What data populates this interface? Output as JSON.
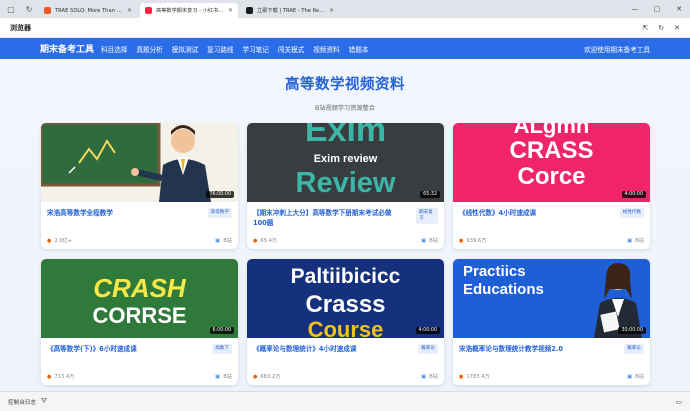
{
  "browser": {
    "tabs": [
      {
        "label": "TRAE SOLO: More Than Co...",
        "favicon_color": "#f15a24",
        "active": false
      },
      {
        "label": "高等数学期末复习 - 小红书搜索",
        "favicon_color": "#ff2442",
        "active": false
      },
      {
        "label": "立即下载 | TRAE - The Real AI Eng...",
        "favicon_color": "#1d1d1d",
        "active": false
      }
    ]
  },
  "preview": {
    "title": "浏览器"
  },
  "nav": {
    "brand": "期末备考工具",
    "items": [
      "科目选择",
      "真题分析",
      "模拟测试",
      "复习路线",
      "学习笔记",
      "闯关模式",
      "视频资料",
      "错题本"
    ],
    "welcome": "欢迎使用期末备考工具"
  },
  "hero": {
    "title": "高等数学视频资料",
    "subtitle": "B站视频学习资源整合"
  },
  "cards": [
    {
      "title": "宋浩高等数学全程教学",
      "tag": "高等数学",
      "views": "2.0亿+",
      "source": "B站",
      "duration": "76:00:00"
    },
    {
      "title": "【期末冲刺上大分】高等数学下册期末考试必做100题",
      "tag": "期末复习",
      "views": "65.4万",
      "source": "B站",
      "duration": "65:32",
      "thumb_words": [
        "Exim",
        "Exim review",
        "Review"
      ]
    },
    {
      "title": "《线性代数》4小时速成课",
      "tag": "线性代数",
      "views": "939.6万",
      "source": "B站",
      "duration": "4:00:00",
      "thumb_words": [
        "ALgmn",
        "CRASS",
        "Corce"
      ]
    },
    {
      "title": "《高等数学(下)》6小时速成课",
      "tag": "高数下",
      "views": "713.4万",
      "source": "B站",
      "duration": "6:00:00",
      "thumb_words": [
        "CRASH",
        "CORRSE"
      ]
    },
    {
      "title": "《概率论与数理统计》4小时速成课",
      "tag": "概率论",
      "views": "683.2万",
      "source": "B站",
      "duration": "4:00:00",
      "thumb_words": [
        "Paltiibicicc",
        "Crasss",
        "Course"
      ]
    },
    {
      "title": "宋浩概率论与数理统计教学视频2.0",
      "tag": "概率论",
      "views": "1783.4万",
      "source": "B站",
      "duration": "30:00:00",
      "thumb_words": [
        "Practiics",
        "Educations"
      ]
    }
  ],
  "statusbar": {
    "label": "控制台日志"
  },
  "colors": {
    "accent": "#2b6de8",
    "title_blue": "#2563d6",
    "card2_bg": "#3a3d40",
    "card3_bg": "#f0246a",
    "card4_bg": "#2f7a3a",
    "card5_bg": "#15307d",
    "card6_bg": "#1f5fd6"
  }
}
